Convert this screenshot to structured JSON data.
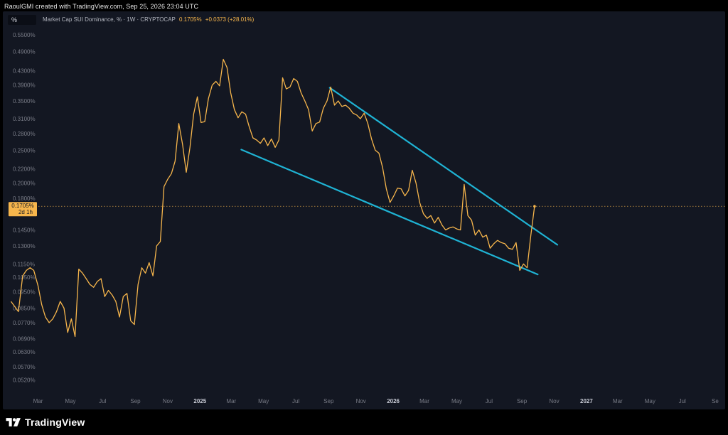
{
  "header": {
    "credit": "RaoulGMI created with TradingView.com, Sep 25, 2026 23:04 UTC"
  },
  "toolbar": {
    "scale_label": "%"
  },
  "legend": {
    "symbol": "Market Cap SUI Dominance, % · 1W · CRYPTOCAP",
    "value": "0.1705%",
    "change": "+0.0373 (+28.01%)"
  },
  "price_tag": {
    "value": "0.1705%",
    "countdown": "2d 1h"
  },
  "brand": {
    "name": "TradingView"
  },
  "colors": {
    "line": "#f7b64c",
    "channel": "#1fb3d4",
    "background": "#131722",
    "text": "#787b86"
  },
  "chart_data": {
    "type": "line",
    "y_scale": "log",
    "ylim": [
      0.046,
      0.58
    ],
    "y_ticks": [
      "0.5500%",
      "0.4900%",
      "0.4300%",
      "0.3900%",
      "0.3500%",
      "0.3100%",
      "0.2800%",
      "0.2500%",
      "0.2200%",
      "0.2000%",
      "0.1800%",
      "0.1450%",
      "0.1300%",
      "0.1150%",
      "0.1050%",
      "0.0950%",
      "0.0850%",
      "0.0770%",
      "0.0690%",
      "0.0630%",
      "0.0570%",
      "0.0520%"
    ],
    "y_tick_values": [
      0.55,
      0.49,
      0.43,
      0.39,
      0.35,
      0.31,
      0.28,
      0.25,
      0.22,
      0.2,
      0.18,
      0.145,
      0.13,
      0.115,
      0.105,
      0.095,
      0.085,
      0.077,
      0.069,
      0.063,
      0.057,
      0.052
    ],
    "x_ticks": [
      "Mar",
      "May",
      "Jul",
      "Sep",
      "Nov",
      "2025",
      "Mar",
      "May",
      "Jul",
      "Sep",
      "Nov",
      "2026",
      "Mar",
      "May",
      "Jul",
      "Sep",
      "Nov",
      "2027",
      "Mar",
      "May",
      "Jul",
      "Se"
    ],
    "x_tick_dates": [
      "2024-03-01",
      "2024-05-01",
      "2024-07-01",
      "2024-09-01",
      "2024-11-01",
      "2025-01-01",
      "2025-03-01",
      "2025-05-01",
      "2025-07-01",
      "2025-09-01",
      "2025-11-01",
      "2026-01-01",
      "2026-03-01",
      "2026-05-01",
      "2026-07-01",
      "2026-09-01",
      "2026-11-01",
      "2027-01-01",
      "2027-03-01",
      "2027-05-01",
      "2027-07-01",
      "2027-09-01"
    ],
    "x_bold": [
      "2025",
      "2026",
      "2027"
    ],
    "xlim": [
      "2024-01-08",
      "2027-09-20"
    ],
    "series": [
      {
        "points": [
          [
            "2024-01-10",
            0.089
          ],
          [
            "2024-01-24",
            0.083
          ],
          [
            "2024-02-01",
            0.106
          ],
          [
            "2024-02-08",
            0.11
          ],
          [
            "2024-02-15",
            0.112
          ],
          [
            "2024-02-22",
            0.11
          ],
          [
            "2024-03-01",
            0.099
          ],
          [
            "2024-03-08",
            0.087
          ],
          [
            "2024-03-15",
            0.08
          ],
          [
            "2024-03-22",
            0.077
          ],
          [
            "2024-03-29",
            0.079
          ],
          [
            "2024-04-05",
            0.083
          ],
          [
            "2024-04-12",
            0.089
          ],
          [
            "2024-04-19",
            0.085
          ],
          [
            "2024-04-26",
            0.072
          ],
          [
            "2024-05-03",
            0.079
          ],
          [
            "2024-05-10",
            0.07
          ],
          [
            "2024-05-17",
            0.111
          ],
          [
            "2024-05-24",
            0.108
          ],
          [
            "2024-05-31",
            0.104
          ],
          [
            "2024-06-07",
            0.1
          ],
          [
            "2024-06-14",
            0.098
          ],
          [
            "2024-06-21",
            0.102
          ],
          [
            "2024-06-28",
            0.104
          ],
          [
            "2024-07-05",
            0.092
          ],
          [
            "2024-07-12",
            0.096
          ],
          [
            "2024-07-19",
            0.093
          ],
          [
            "2024-07-26",
            0.089
          ],
          [
            "2024-08-02",
            0.08
          ],
          [
            "2024-08-09",
            0.092
          ],
          [
            "2024-08-16",
            0.094
          ],
          [
            "2024-08-23",
            0.078
          ],
          [
            "2024-08-30",
            0.076
          ],
          [
            "2024-09-06",
            0.1
          ],
          [
            "2024-09-13",
            0.112
          ],
          [
            "2024-09-20",
            0.108
          ],
          [
            "2024-09-27",
            0.116
          ],
          [
            "2024-10-04",
            0.106
          ],
          [
            "2024-10-11",
            0.13
          ],
          [
            "2024-10-18",
            0.134
          ],
          [
            "2024-10-25",
            0.195
          ],
          [
            "2024-11-01",
            0.205
          ],
          [
            "2024-11-08",
            0.213
          ],
          [
            "2024-11-15",
            0.232
          ],
          [
            "2024-11-22",
            0.3
          ],
          [
            "2024-11-29",
            0.26
          ],
          [
            "2024-12-06",
            0.215
          ],
          [
            "2024-12-13",
            0.255
          ],
          [
            "2024-12-20",
            0.32
          ],
          [
            "2024-12-27",
            0.36
          ],
          [
            "2025-01-03",
            0.302
          ],
          [
            "2025-01-10",
            0.304
          ],
          [
            "2025-01-17",
            0.356
          ],
          [
            "2025-01-24",
            0.39
          ],
          [
            "2025-01-31",
            0.4
          ],
          [
            "2025-02-07",
            0.388
          ],
          [
            "2025-02-14",
            0.465
          ],
          [
            "2025-02-21",
            0.44
          ],
          [
            "2025-02-28",
            0.37
          ],
          [
            "2025-03-07",
            0.33
          ],
          [
            "2025-03-14",
            0.312
          ],
          [
            "2025-03-21",
            0.325
          ],
          [
            "2025-03-28",
            0.32
          ],
          [
            "2025-04-04",
            0.293
          ],
          [
            "2025-04-11",
            0.272
          ],
          [
            "2025-04-18",
            0.268
          ],
          [
            "2025-04-25",
            0.262
          ],
          [
            "2025-05-02",
            0.272
          ],
          [
            "2025-05-09",
            0.258
          ],
          [
            "2025-05-16",
            0.27
          ],
          [
            "2025-05-23",
            0.255
          ],
          [
            "2025-05-30",
            0.268
          ],
          [
            "2025-06-06",
            0.41
          ],
          [
            "2025-06-13",
            0.38
          ],
          [
            "2025-06-20",
            0.385
          ],
          [
            "2025-06-27",
            0.408
          ],
          [
            "2025-07-04",
            0.4
          ],
          [
            "2025-07-11",
            0.37
          ],
          [
            "2025-07-18",
            0.35
          ],
          [
            "2025-07-25",
            0.33
          ],
          [
            "2025-08-01",
            0.285
          ],
          [
            "2025-08-08",
            0.3
          ],
          [
            "2025-08-15",
            0.303
          ],
          [
            "2025-08-22",
            0.333
          ],
          [
            "2025-08-29",
            0.35
          ],
          [
            "2025-09-05",
            0.385
          ],
          [
            "2025-09-12",
            0.34
          ],
          [
            "2025-09-19",
            0.35
          ],
          [
            "2025-09-26",
            0.337
          ],
          [
            "2025-10-03",
            0.34
          ],
          [
            "2025-10-10",
            0.333
          ],
          [
            "2025-10-17",
            0.322
          ],
          [
            "2025-10-24",
            0.318
          ],
          [
            "2025-10-31",
            0.31
          ],
          [
            "2025-11-07",
            0.322
          ],
          [
            "2025-11-14",
            0.3
          ],
          [
            "2025-11-21",
            0.27
          ],
          [
            "2025-11-28",
            0.25
          ],
          [
            "2025-12-05",
            0.245
          ],
          [
            "2025-12-12",
            0.222
          ],
          [
            "2025-12-19",
            0.192
          ],
          [
            "2025-12-26",
            0.175
          ],
          [
            "2026-01-02",
            0.183
          ],
          [
            "2026-01-09",
            0.193
          ],
          [
            "2026-01-16",
            0.192
          ],
          [
            "2026-01-23",
            0.183
          ],
          [
            "2026-01-30",
            0.19
          ],
          [
            "2026-02-06",
            0.218
          ],
          [
            "2026-02-13",
            0.2
          ],
          [
            "2026-02-20",
            0.175
          ],
          [
            "2026-02-27",
            0.162
          ],
          [
            "2026-03-06",
            0.157
          ],
          [
            "2026-03-13",
            0.16
          ],
          [
            "2026-03-20",
            0.152
          ],
          [
            "2026-03-27",
            0.158
          ],
          [
            "2026-04-03",
            0.15
          ],
          [
            "2026-04-10",
            0.145
          ],
          [
            "2026-04-17",
            0.147
          ],
          [
            "2026-04-24",
            0.148
          ],
          [
            "2026-05-01",
            0.146
          ],
          [
            "2026-05-08",
            0.145
          ],
          [
            "2026-05-15",
            0.198
          ],
          [
            "2026-05-22",
            0.16
          ],
          [
            "2026-05-29",
            0.155
          ],
          [
            "2026-06-05",
            0.14
          ],
          [
            "2026-06-12",
            0.145
          ],
          [
            "2026-06-19",
            0.138
          ],
          [
            "2026-06-26",
            0.14
          ],
          [
            "2026-07-03",
            0.128
          ],
          [
            "2026-07-10",
            0.132
          ],
          [
            "2026-07-17",
            0.135
          ],
          [
            "2026-07-24",
            0.133
          ],
          [
            "2026-07-31",
            0.132
          ],
          [
            "2026-08-07",
            0.128
          ],
          [
            "2026-08-14",
            0.127
          ],
          [
            "2026-08-21",
            0.133
          ],
          [
            "2026-08-28",
            0.11
          ],
          [
            "2026-09-04",
            0.115
          ],
          [
            "2026-09-11",
            0.112
          ],
          [
            "2026-09-18",
            0.14
          ],
          [
            "2026-09-25",
            0.1705
          ]
        ]
      }
    ],
    "trendlines": [
      {
        "from": [
          "2025-09-03",
          0.383
        ],
        "to": [
          "2026-11-07",
          0.131
        ]
      },
      {
        "from": [
          "2025-03-20",
          0.251
        ],
        "to": [
          "2026-10-01",
          0.107
        ]
      }
    ],
    "last_value": 0.1705
  }
}
